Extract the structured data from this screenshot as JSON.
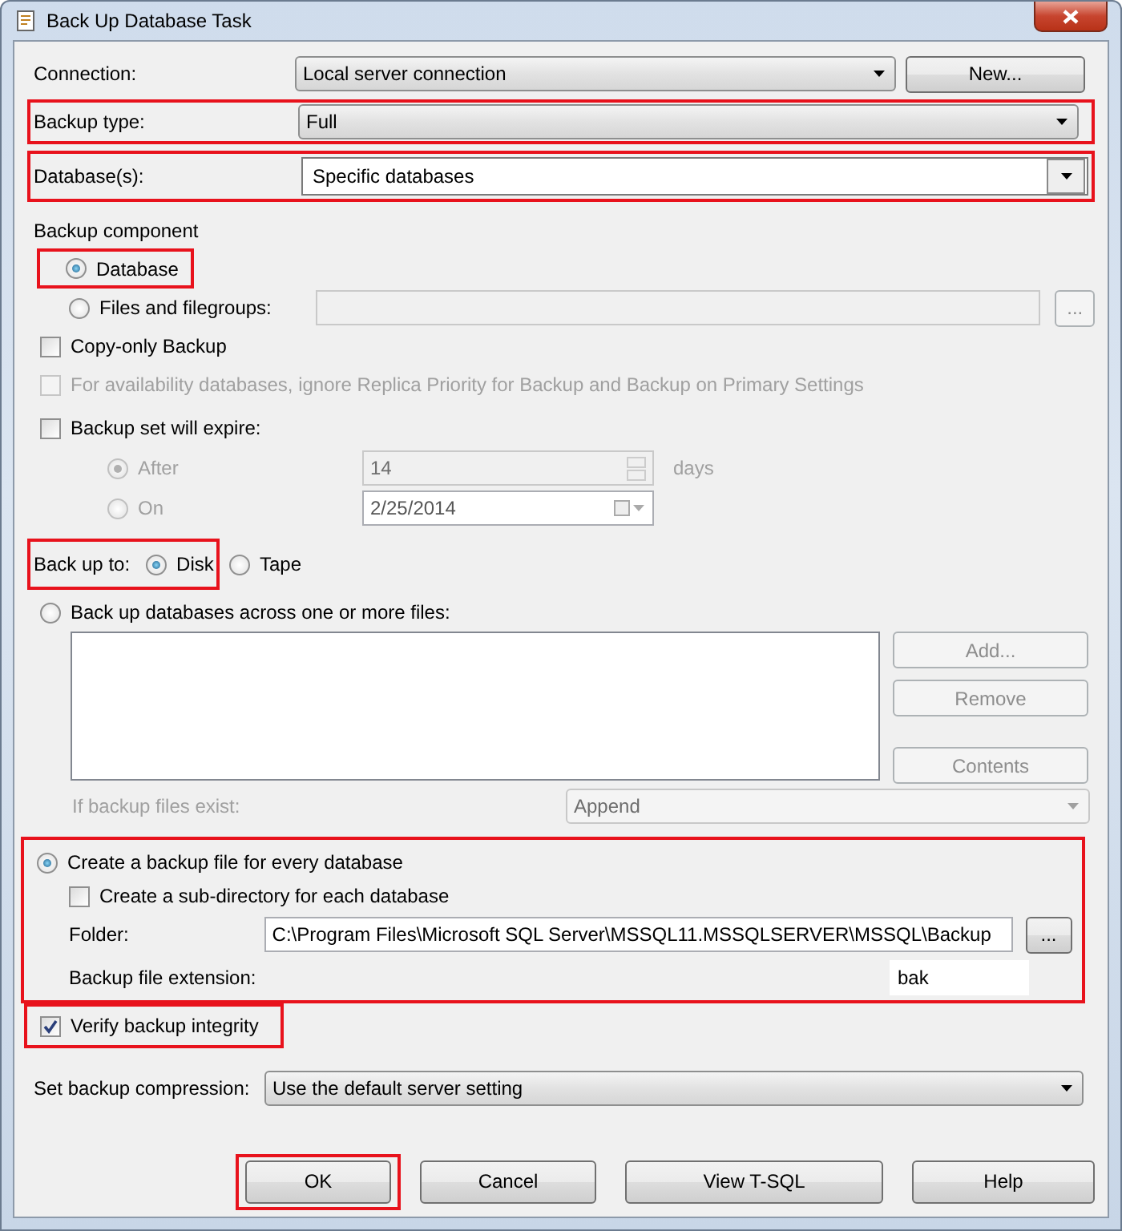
{
  "window": {
    "title": "Back Up Database Task"
  },
  "connection": {
    "label": "Connection:",
    "value": "Local server connection",
    "button": "New..."
  },
  "backup_type": {
    "label": "Backup type:",
    "value": "Full",
    "highlighted": true
  },
  "databases": {
    "label": "Database(s):",
    "value": "Specific databases",
    "highlighted": true
  },
  "backup_component": {
    "label": "Backup component",
    "options": [
      {
        "label": "Database",
        "selected": true,
        "highlighted": true
      },
      {
        "label": "Files and filegroups:",
        "selected": false
      }
    ],
    "browse_button": "..."
  },
  "options": [
    {
      "label": "Copy-only Backup",
      "checked": false,
      "disabled": false
    },
    {
      "label": "For availability databases, ignore Replica Priority for Backup and Backup on Primary Settings",
      "checked": false,
      "disabled": true
    }
  ],
  "expire": {
    "label": "Backup set will expire:",
    "checked": false,
    "after": {
      "label": "After",
      "selected": true,
      "value": "14",
      "unit": "days"
    },
    "on": {
      "label": "On",
      "selected": false,
      "value": "2/25/2014"
    }
  },
  "backup_to": {
    "label": "Back up to:",
    "highlighted": true,
    "options": [
      {
        "label": "Disk",
        "selected": true
      },
      {
        "label": "Tape",
        "selected": false
      }
    ]
  },
  "files": {
    "label": "Back up databases across one or more files:",
    "selected": false,
    "buttons": [
      {
        "label": "Add...",
        "disabled": true
      },
      {
        "label": "Remove",
        "disabled": true
      },
      {
        "label": "Contents",
        "disabled": true
      }
    ],
    "exist_label": "If backup files exist:",
    "exist_value": "Append"
  },
  "per_database": {
    "highlighted": true,
    "label": "Create a backup file for every database",
    "selected": true,
    "subdir": {
      "label": "Create a sub-directory for each database",
      "checked": false
    },
    "folder_label": "Folder:",
    "folder": "C:\\Program Files\\Microsoft SQL Server\\MSSQL11.MSSQLSERVER\\MSSQL\\Backup",
    "browse_button": "...",
    "ext_label": "Backup file extension:",
    "ext": "bak"
  },
  "verify": {
    "label": "Verify backup integrity",
    "checked": true,
    "highlighted": true
  },
  "compression": {
    "label": "Set backup compression:",
    "value": "Use the default server setting"
  },
  "buttons": [
    {
      "label": "OK",
      "highlighted": true
    },
    {
      "label": "Cancel",
      "highlighted": false
    },
    {
      "label": "View T-SQL",
      "highlighted": false
    },
    {
      "label": "Help",
      "highlighted": false
    }
  ]
}
